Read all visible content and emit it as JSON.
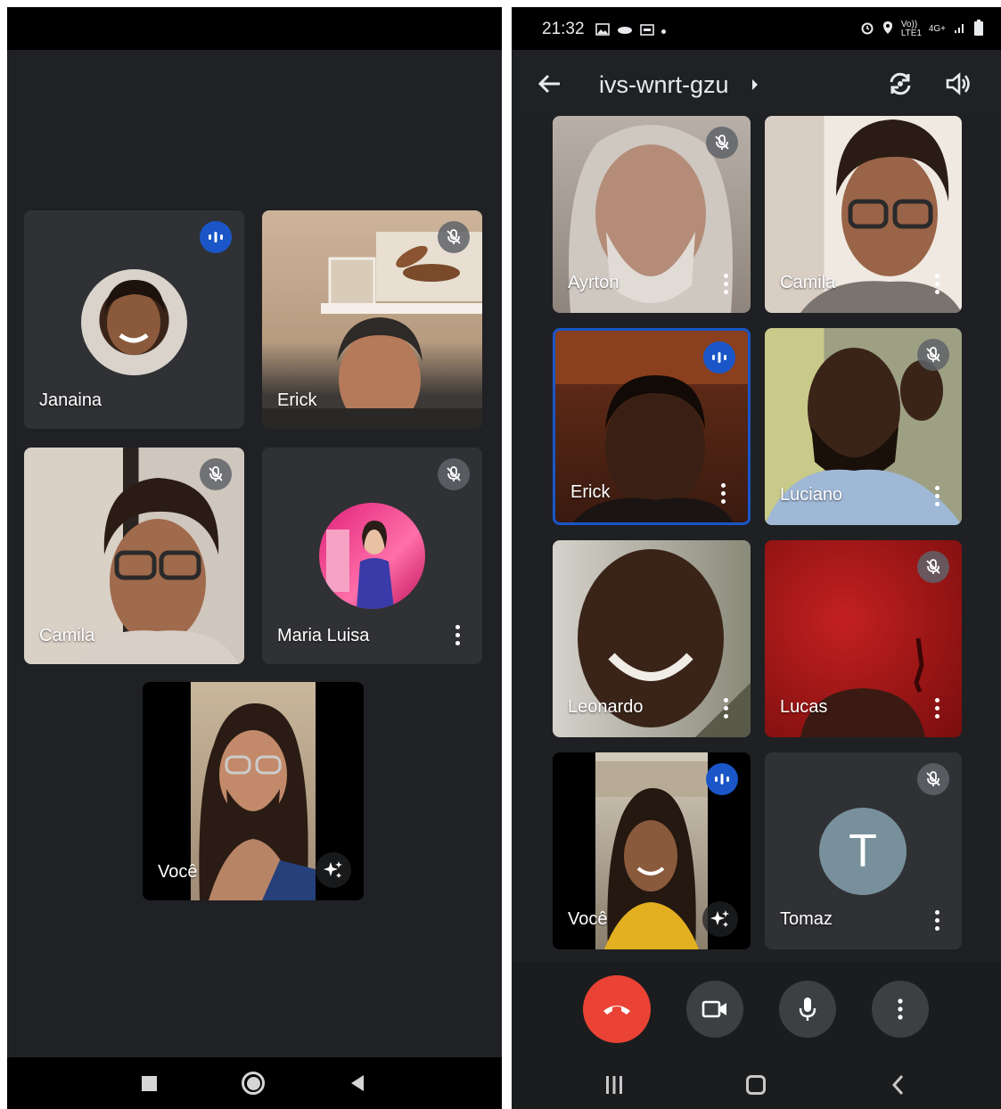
{
  "left": {
    "tiles": [
      {
        "name": "Janaina"
      },
      {
        "name": "Erick"
      },
      {
        "name": "Camila"
      },
      {
        "name": "Maria Luisa"
      },
      {
        "name": "Você"
      }
    ]
  },
  "right": {
    "status": {
      "time": "21:32",
      "network": "4G+",
      "volte_label": "Vo)) LTE1"
    },
    "meeting": {
      "title": "ivs-wnrt-gzu"
    },
    "tiles": [
      {
        "name": "Ayrton"
      },
      {
        "name": "Camila"
      },
      {
        "name": "Erick"
      },
      {
        "name": "Luciano"
      },
      {
        "name": "Leonardo"
      },
      {
        "name": "Lucas"
      },
      {
        "name": "Você"
      },
      {
        "name": "Tomaz",
        "initial": "T"
      }
    ]
  },
  "colors": {
    "talking": "#1a56c8",
    "hangup": "#ea4335",
    "active_border": "#1a56c8",
    "background": "#202124"
  }
}
